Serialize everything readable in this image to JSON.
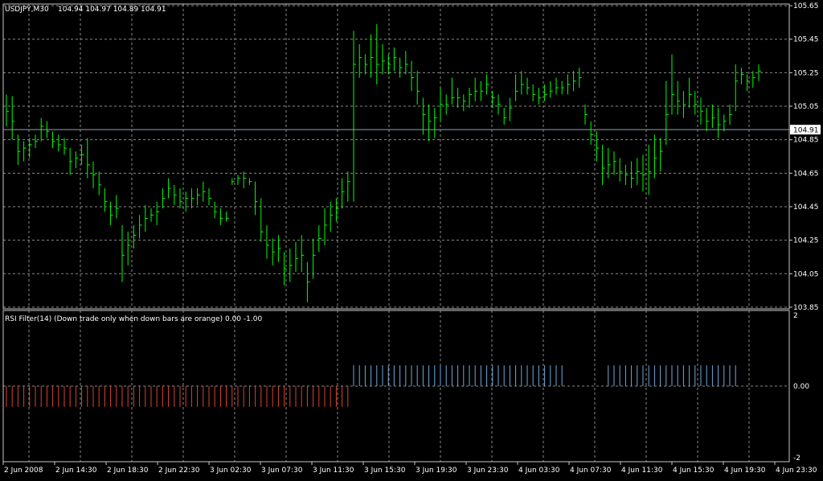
{
  "window": {
    "symbol_label": "USDJPY,M30",
    "ohlc_label": "104.94 104.97 104.89 104.91"
  },
  "colors": {
    "background": "#000000",
    "grid": "#8a8a8a",
    "frame": "#c8c8c8",
    "price_bars": "#00ff00",
    "bid_line": "#8fa3b8",
    "rsi_up": "#6fa8dc",
    "rsi_down": "#d9452b",
    "text": "#ffffff"
  },
  "chart_data": [
    {
      "type": "bar",
      "title": "USDJPY,M30",
      "subtitle": "104.94 104.97 104.89 104.91",
      "price_axis_ticks": [
        "105.65",
        "105.45",
        "105.25",
        "105.05",
        "104.85",
        "104.65",
        "104.45",
        "104.25",
        "104.05",
        "103.85"
      ],
      "ylim": [
        103.84,
        105.66
      ],
      "current_price_label": "104.91",
      "current_price": 104.91,
      "grid": true,
      "note_x": "bar index",
      "bars_high_low_close": [
        [
          105.12,
          104.93,
          105.02
        ],
        [
          105.11,
          104.85,
          104.96
        ],
        [
          104.88,
          104.7,
          104.78
        ],
        [
          104.84,
          104.72,
          104.8
        ],
        [
          104.86,
          104.74,
          104.82
        ],
        [
          104.88,
          104.8,
          104.84
        ],
        [
          104.98,
          104.84,
          104.93
        ],
        [
          104.96,
          104.86,
          104.9
        ],
        [
          104.9,
          104.8,
          104.84
        ],
        [
          104.88,
          104.78,
          104.82
        ],
        [
          104.86,
          104.76,
          104.8
        ],
        [
          104.8,
          104.64,
          104.72
        ],
        [
          104.78,
          104.68,
          104.74
        ],
        [
          104.82,
          104.7,
          104.76
        ],
        [
          104.86,
          104.62,
          104.7
        ],
        [
          104.72,
          104.56,
          104.64
        ],
        [
          104.66,
          104.52,
          104.58
        ],
        [
          104.56,
          104.42,
          104.48
        ],
        [
          104.48,
          104.34,
          104.4
        ],
        [
          104.52,
          104.38,
          104.44
        ],
        [
          104.34,
          104.0,
          104.16
        ],
        [
          104.3,
          104.1,
          104.22
        ],
        [
          104.34,
          104.2,
          104.28
        ],
        [
          104.4,
          104.26,
          104.34
        ],
        [
          104.46,
          104.3,
          104.38
        ],
        [
          104.44,
          104.36,
          104.4
        ],
        [
          104.48,
          104.34,
          104.42
        ],
        [
          104.56,
          104.44,
          104.5
        ],
        [
          104.62,
          104.5,
          104.56
        ],
        [
          104.58,
          104.46,
          104.52
        ],
        [
          104.56,
          104.44,
          104.48
        ],
        [
          104.54,
          104.42,
          104.5
        ],
        [
          104.56,
          104.44,
          104.5
        ],
        [
          104.56,
          104.46,
          104.52
        ],
        [
          104.6,
          104.48,
          104.54
        ],
        [
          104.56,
          104.46,
          104.5
        ],
        [
          104.48,
          104.38,
          104.42
        ],
        [
          104.44,
          104.34,
          104.38
        ],
        [
          104.42,
          104.36,
          104.38
        ],
        [
          104.62,
          104.58,
          104.6
        ],
        [
          104.64,
          104.58,
          104.62
        ],
        [
          104.66,
          104.56,
          104.62
        ],
        [
          104.62,
          104.58,
          104.6
        ],
        [
          104.6,
          104.4,
          104.48
        ],
        [
          104.5,
          104.24,
          104.3
        ],
        [
          104.34,
          104.14,
          104.22
        ],
        [
          104.26,
          104.1,
          104.18
        ],
        [
          104.28,
          104.12,
          104.2
        ],
        [
          104.18,
          103.98,
          104.08
        ],
        [
          104.2,
          104.0,
          104.1
        ],
        [
          104.24,
          104.06,
          104.14
        ],
        [
          104.28,
          104.06,
          104.16
        ],
        [
          104.12,
          103.88,
          104.0
        ],
        [
          104.26,
          104.02,
          104.16
        ],
        [
          104.34,
          104.18,
          104.26
        ],
        [
          104.44,
          104.22,
          104.34
        ],
        [
          104.48,
          104.3,
          104.4
        ],
        [
          104.5,
          104.36,
          104.44
        ],
        [
          104.62,
          104.44,
          104.54
        ],
        [
          104.66,
          104.48,
          104.6
        ],
        [
          105.5,
          104.48,
          105.3
        ],
        [
          105.42,
          105.22,
          105.34
        ],
        [
          105.36,
          105.24,
          105.3
        ],
        [
          105.48,
          105.22,
          105.34
        ],
        [
          105.54,
          105.18,
          105.3
        ],
        [
          105.42,
          105.24,
          105.32
        ],
        [
          105.36,
          105.24,
          105.3
        ],
        [
          105.4,
          105.26,
          105.34
        ],
        [
          105.34,
          105.22,
          105.28
        ],
        [
          105.38,
          105.24,
          105.3
        ],
        [
          105.32,
          105.14,
          105.22
        ],
        [
          105.26,
          105.06,
          105.14
        ],
        [
          105.1,
          104.88,
          105.0
        ],
        [
          105.06,
          104.84,
          104.96
        ],
        [
          105.04,
          104.86,
          104.98
        ],
        [
          105.16,
          104.96,
          105.06
        ],
        [
          105.12,
          105.0,
          105.06
        ],
        [
          105.22,
          105.06,
          105.1
        ],
        [
          105.16,
          105.04,
          105.1
        ],
        [
          105.12,
          105.02,
          105.08
        ],
        [
          105.16,
          105.04,
          105.12
        ],
        [
          105.22,
          105.08,
          105.14
        ],
        [
          105.2,
          105.08,
          105.14
        ],
        [
          105.24,
          105.12,
          105.18
        ],
        [
          105.14,
          105.04,
          105.1
        ],
        [
          105.12,
          105.0,
          105.06
        ],
        [
          105.04,
          104.94,
          104.98
        ],
        [
          105.1,
          104.96,
          105.04
        ],
        [
          105.24,
          105.08,
          105.14
        ],
        [
          105.26,
          105.12,
          105.18
        ],
        [
          105.22,
          105.12,
          105.16
        ],
        [
          105.18,
          105.08,
          105.12
        ],
        [
          105.16,
          105.06,
          105.1
        ],
        [
          105.18,
          105.08,
          105.12
        ],
        [
          105.2,
          105.1,
          105.14
        ],
        [
          105.22,
          105.12,
          105.16
        ],
        [
          105.2,
          105.12,
          105.16
        ],
        [
          105.24,
          105.12,
          105.18
        ],
        [
          105.26,
          105.14,
          105.2
        ],
        [
          105.28,
          105.16,
          105.22
        ],
        [
          105.06,
          104.94,
          105.0
        ],
        [
          104.96,
          104.82,
          104.88
        ],
        [
          104.9,
          104.72,
          104.8
        ],
        [
          104.82,
          104.58,
          104.68
        ],
        [
          104.8,
          104.62,
          104.7
        ],
        [
          104.78,
          104.64,
          104.72
        ],
        [
          104.74,
          104.6,
          104.66
        ],
        [
          104.7,
          104.58,
          104.64
        ],
        [
          104.72,
          104.56,
          104.62
        ],
        [
          104.74,
          104.58,
          104.66
        ],
        [
          104.76,
          104.54,
          104.64
        ],
        [
          104.82,
          104.52,
          104.66
        ],
        [
          104.88,
          104.62,
          104.74
        ],
        [
          104.86,
          104.66,
          104.78
        ],
        [
          105.2,
          104.82,
          105.0
        ],
        [
          105.36,
          105.0,
          105.12
        ],
        [
          105.2,
          105.0,
          105.08
        ],
        [
          105.14,
          104.98,
          105.06
        ],
        [
          105.22,
          105.04,
          105.12
        ],
        [
          105.14,
          105.0,
          105.06
        ],
        [
          105.1,
          104.94,
          105.02
        ],
        [
          105.04,
          104.9,
          104.96
        ],
        [
          105.06,
          104.92,
          104.98
        ],
        [
          105.04,
          104.86,
          104.94
        ],
        [
          105.0,
          104.9,
          104.96
        ],
        [
          105.06,
          104.94,
          105.0
        ],
        [
          105.3,
          105.02,
          105.2
        ],
        [
          105.28,
          105.18,
          105.24
        ],
        [
          105.24,
          105.14,
          105.2
        ],
        [
          105.26,
          105.16,
          105.22
        ],
        [
          105.3,
          105.2,
          105.26
        ]
      ]
    },
    {
      "type": "bar",
      "title": "RSI Filter(14)  (Down trade only when down bars are orange) 0.00 -1.00",
      "axis_ticks": [
        "2",
        "0.00",
        "-2"
      ],
      "ylim": [
        -2,
        2
      ],
      "grid": true,
      "series": [
        {
          "name": "Down trade only when down bars are orange",
          "value": -1,
          "from_bar": 0,
          "to_bar": 59
        },
        {
          "name": "Up",
          "value": 1,
          "from_bar": 60,
          "to_bar": 96
        },
        {
          "name": "Up",
          "value": 1,
          "from_bar": 104,
          "to_bar": 126
        }
      ]
    }
  ],
  "time_axis": {
    "labels": [
      "2 Jun 2008",
      "2 Jun 14:30",
      "2 Jun 18:30",
      "2 Jun 22:30",
      "3 Jun 02:30",
      "3 Jun 07:30",
      "3 Jun 11:30",
      "3 Jun 15:30",
      "3 Jun 19:30",
      "3 Jun 23:30",
      "4 Jun 03:30",
      "4 Jun 07:30",
      "4 Jun 11:30",
      "4 Jun 15:30",
      "4 Jun 19:30",
      "4 Jun 23:30"
    ]
  }
}
